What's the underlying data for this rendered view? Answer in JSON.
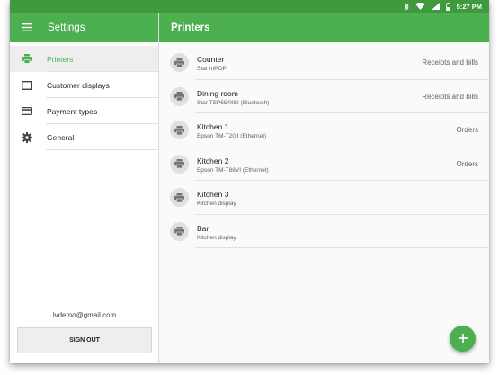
{
  "status_bar": {
    "time": "5:27 PM",
    "icons": [
      "bluetooth-icon",
      "wifi-icon",
      "signal-icon",
      "battery-icon"
    ]
  },
  "settings": {
    "title": "Settings",
    "menu_icon": "hamburger-menu-icon",
    "nav": [
      {
        "label": "Printers",
        "icon": "printer-icon",
        "active": true
      },
      {
        "label": "Customer displays",
        "icon": "display-icon",
        "active": false
      },
      {
        "label": "Payment types",
        "icon": "credit-card-icon",
        "active": false
      },
      {
        "label": "General",
        "icon": "gear-icon",
        "active": false
      }
    ],
    "email": "lvdemo@gmail.com",
    "sign_out_label": "SIGN OUT"
  },
  "printers": {
    "title": "Printers",
    "items": [
      {
        "name": "Counter",
        "model": "Star mPOP",
        "purpose": "Receipts and bills"
      },
      {
        "name": "Dining room",
        "model": "Star TSP654IIBI (Bluetooth)",
        "purpose": "Receipts and bills"
      },
      {
        "name": "Kitchen 1",
        "model": "Epson TM-T20II (Ethernet)",
        "purpose": "Orders"
      },
      {
        "name": "Kitchen 2",
        "model": "Epson TM-T88VI (Ethernet)",
        "purpose": "Orders"
      },
      {
        "name": "Kitchen 3",
        "model": "Kitchen display",
        "purpose": ""
      },
      {
        "name": "Bar",
        "model": "Kitchen display",
        "purpose": ""
      }
    ],
    "fab_label": "+"
  },
  "colors": {
    "primary": "#4caf50",
    "status_bar": "#3e9a3c",
    "active_nav_bg": "#eeeeee"
  }
}
